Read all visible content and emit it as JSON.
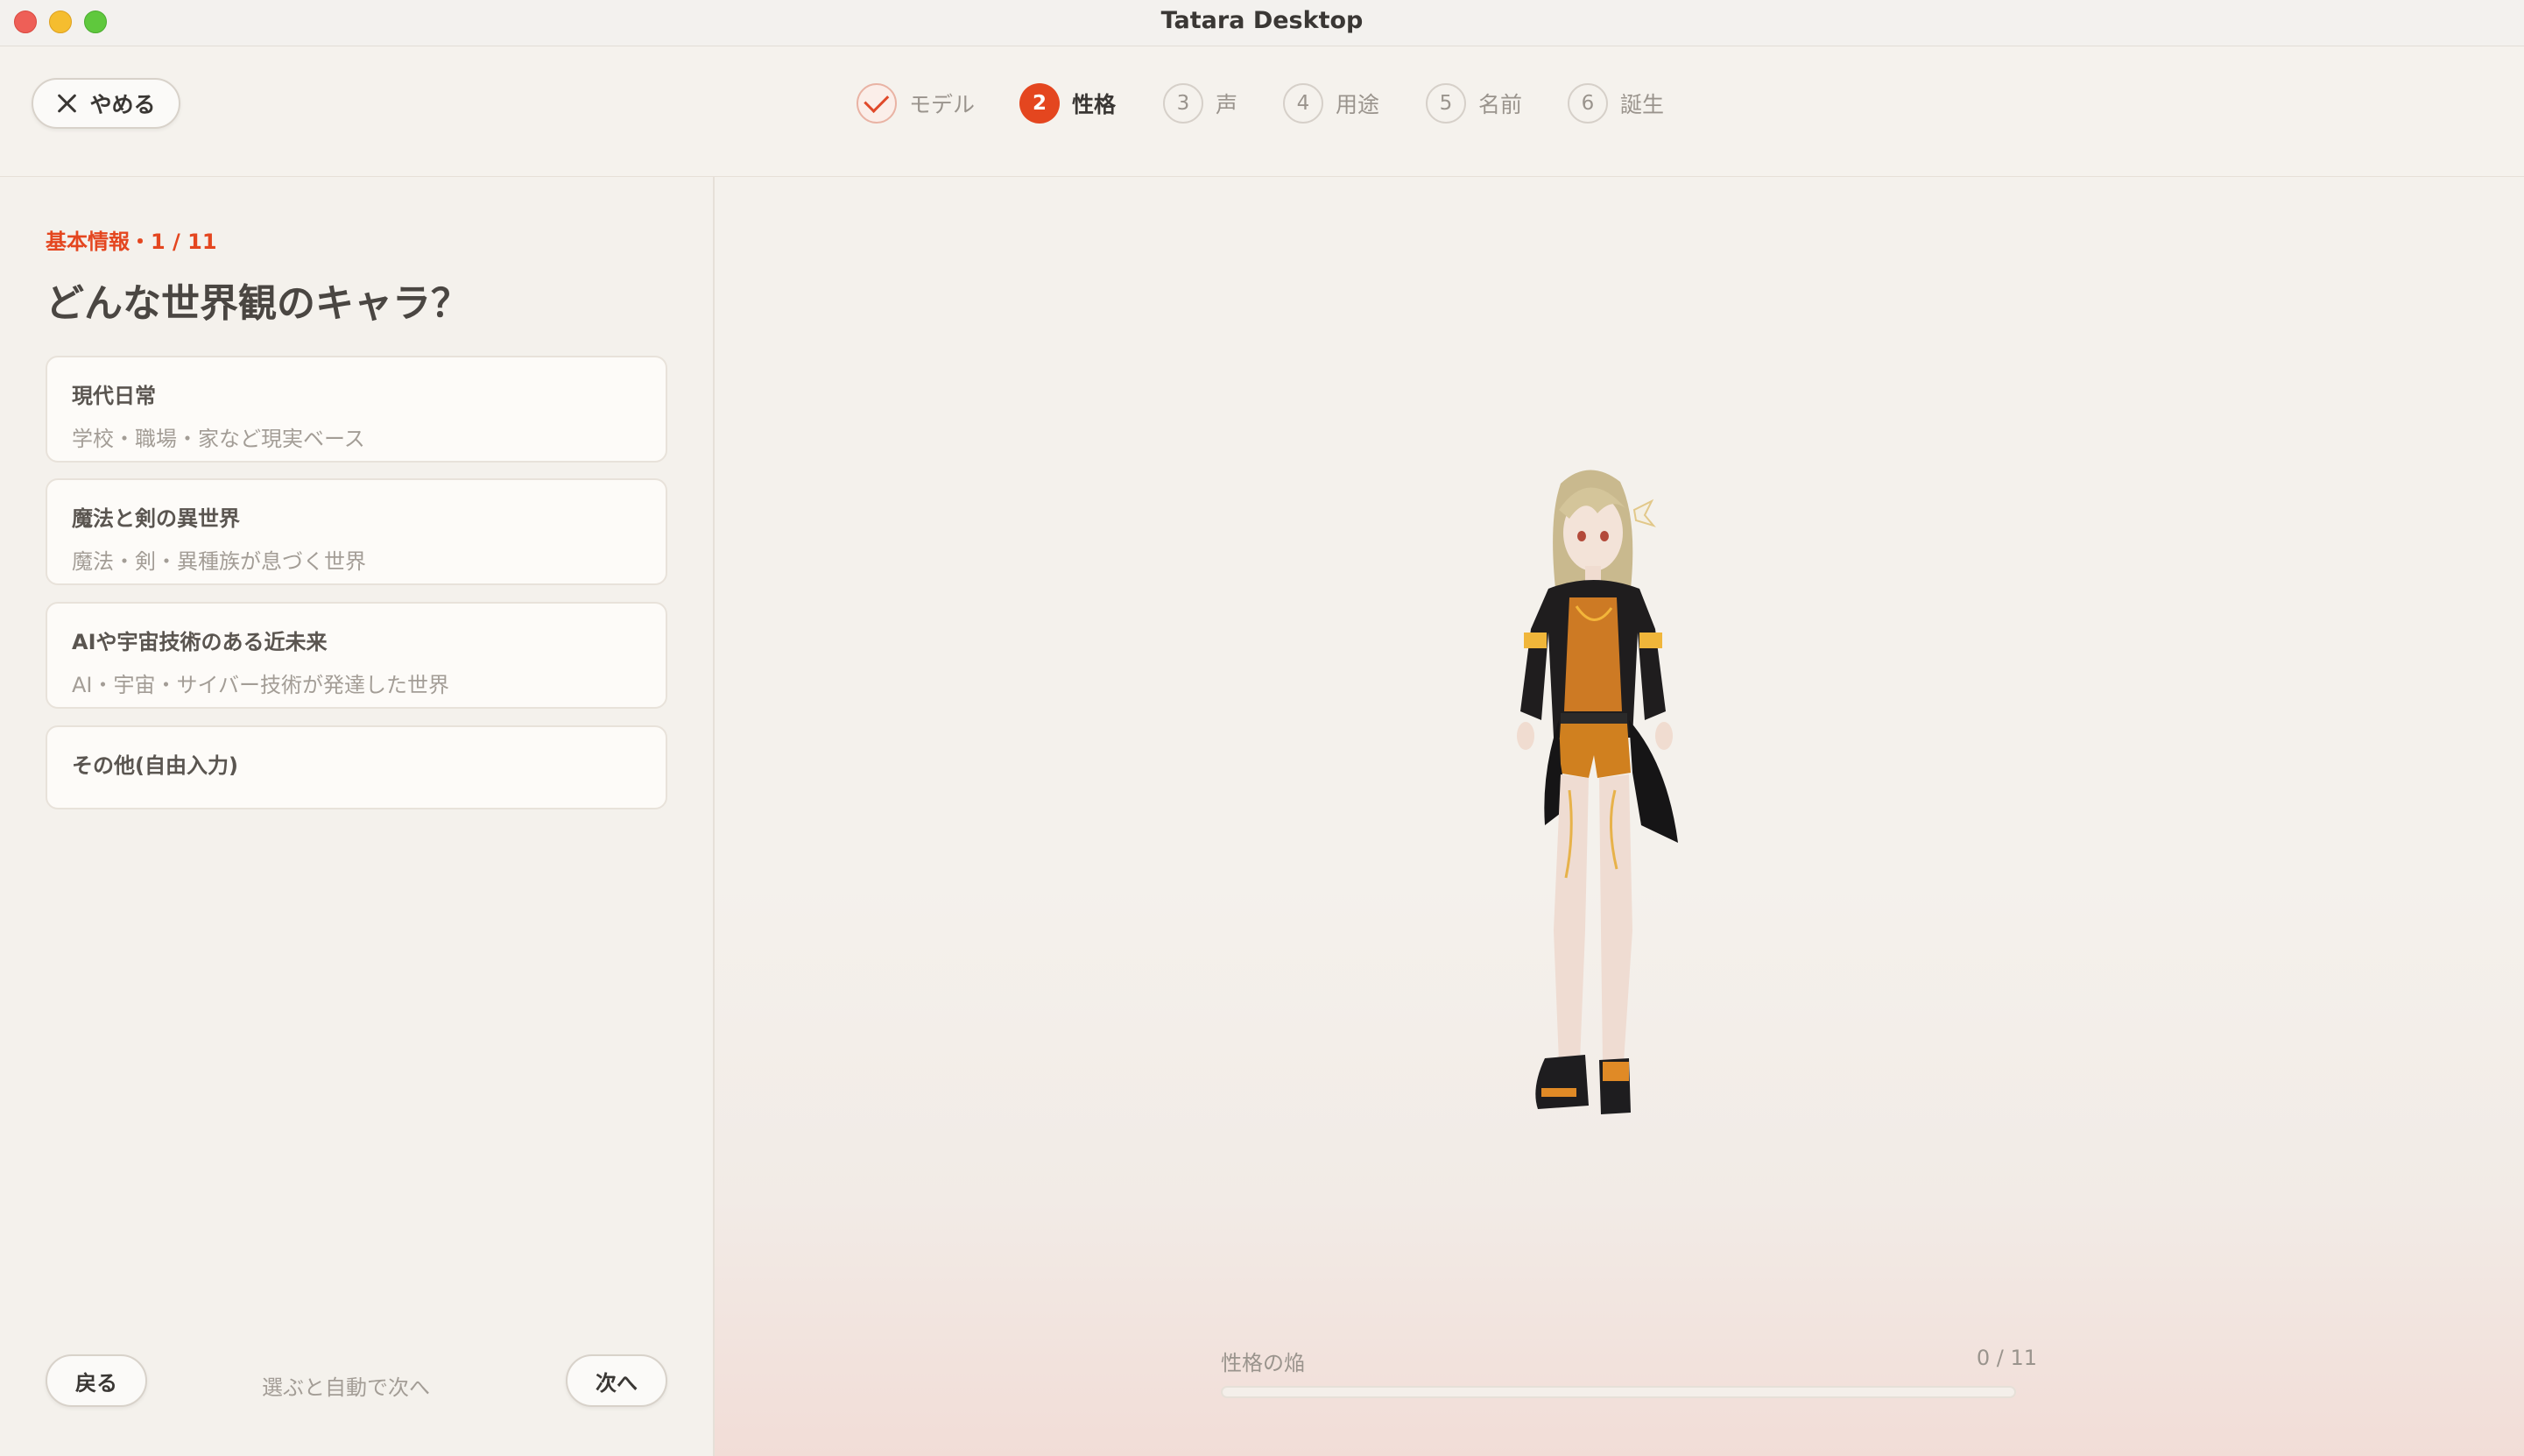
{
  "window": {
    "title": "Tatara Desktop"
  },
  "header": {
    "quit_label": "やめる",
    "steps": [
      {
        "num": "1",
        "label": "モデル",
        "state": "done"
      },
      {
        "num": "2",
        "label": "性格",
        "state": "active"
      },
      {
        "num": "3",
        "label": "声",
        "state": "pending"
      },
      {
        "num": "4",
        "label": "用途",
        "state": "pending"
      },
      {
        "num": "5",
        "label": "名前",
        "state": "pending"
      },
      {
        "num": "6",
        "label": "誕生",
        "state": "pending"
      }
    ]
  },
  "question": {
    "kicker": "基本情報・1 / 11",
    "title": "どんな世界観のキャラ？",
    "options": [
      {
        "title": "現代日常",
        "subtitle": "学校・職場・家など現実ベース"
      },
      {
        "title": "魔法と剣の異世界",
        "subtitle": "魔法・剣・異種族が息づく世界"
      },
      {
        "title": "AIや宇宙技術のある近未来",
        "subtitle": "AI・宇宙・サイバー技術が発達した世界"
      },
      {
        "title": "その他(自由入力)",
        "subtitle": ""
      }
    ]
  },
  "footer": {
    "back_label": "戻る",
    "hint": "選ぶと自動で次へ",
    "next_label": "次へ"
  },
  "preview": {
    "progress_label": "性格の焔",
    "progress_count": "0 / 11",
    "progress_fraction": 0
  },
  "colors": {
    "accent": "#e4461f",
    "background": "#f4f1ec"
  }
}
